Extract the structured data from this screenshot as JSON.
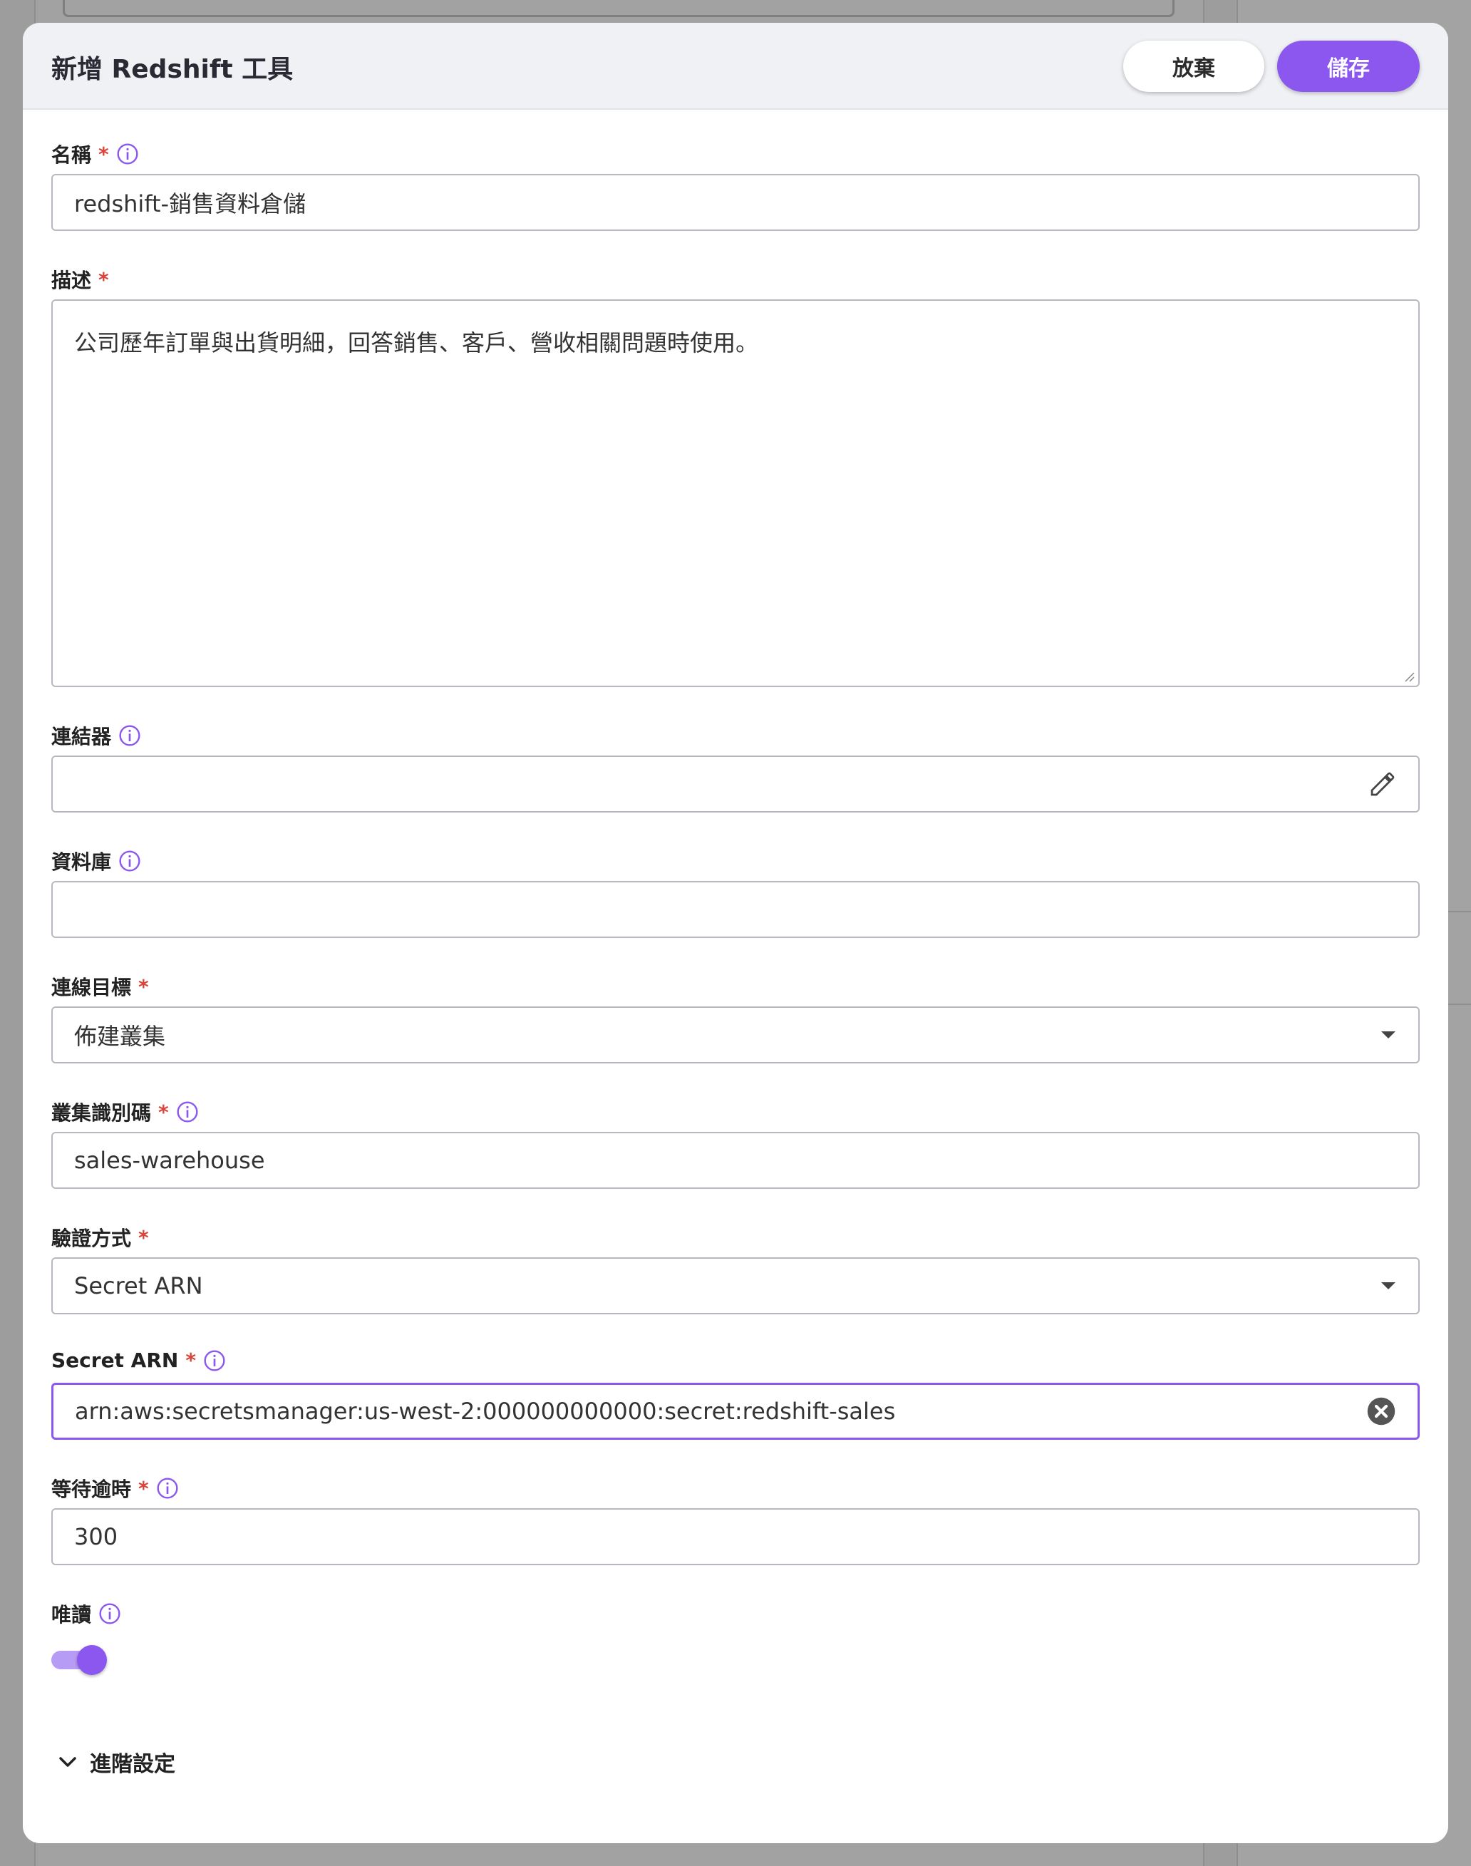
{
  "modal": {
    "title": "新增 Redshift 工具",
    "cancel_label": "放棄",
    "save_label": "儲存"
  },
  "fields": {
    "name": {
      "label": "名稱",
      "required": "*",
      "value": "redshift-銷售資料倉儲"
    },
    "description": {
      "label": "描述",
      "required": "*",
      "value": "公司歷年訂單與出貨明細，回答銷售、客戶、營收相關問題時使用。"
    },
    "connector": {
      "label": "連結器",
      "value": ""
    },
    "database": {
      "label": "資料庫",
      "value": ""
    },
    "connection_target": {
      "label": "連線目標",
      "required": "*",
      "value": "佈建叢集"
    },
    "cluster_id": {
      "label": "叢集識別碼",
      "required": "*",
      "value": "sales-warehouse"
    },
    "auth_method": {
      "label": "驗證方式",
      "required": "*",
      "value": "Secret ARN"
    },
    "secret_arn": {
      "label": "Secret ARN",
      "required": "*",
      "value": "arn:aws:secretsmanager:us-west-2:000000000000:secret:redshift-sales"
    },
    "timeout": {
      "label": "等待逾時",
      "required": "*",
      "value": "300"
    },
    "read_only": {
      "label": "唯讀",
      "enabled": true
    }
  },
  "advanced": {
    "label": "進階設定"
  },
  "colors": {
    "accent": "#8b57ef",
    "required": "#d9443a"
  }
}
